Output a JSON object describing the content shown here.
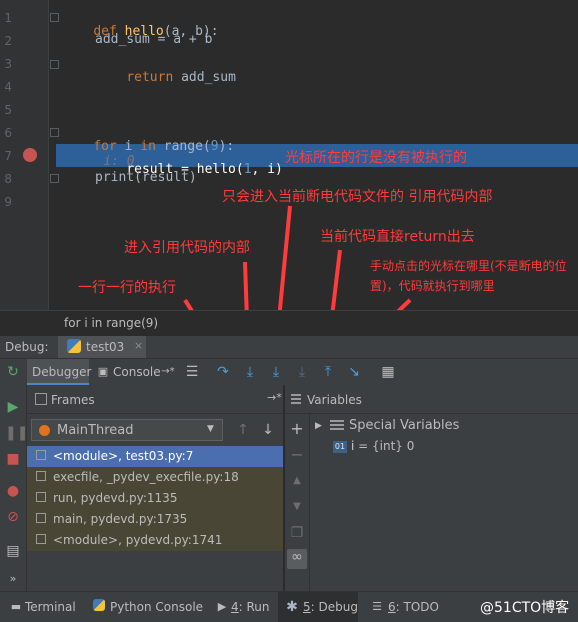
{
  "editor": {
    "lines": [
      {
        "num": "1"
      },
      {
        "num": "2"
      },
      {
        "num": "3"
      },
      {
        "num": "4"
      },
      {
        "num": "5"
      },
      {
        "num": "6"
      },
      {
        "num": "7"
      },
      {
        "num": "8"
      },
      {
        "num": "9"
      }
    ],
    "code": {
      "l1_kw": "def",
      "l1_fn": "hello",
      "l1_rest": "(a, b):",
      "l2": "add_sum = a + b",
      "l3_kw": "return",
      "l3_rest": " add_sum",
      "l6_kw1": "for",
      "l6_mid": " i ",
      "l6_kw2": "in",
      "l6_rest1": " range(",
      "l6_num": "9",
      "l6_rest2": "):",
      "l6_hint": "i: 0",
      "l7_a": "result = hello(",
      "l7_n1": "1",
      "l7_b": ", i)",
      "l8": "print(result)"
    },
    "breadcrumb": "for i in range(9)"
  },
  "annotations": {
    "cursor_line": "光标所在的行是没有被执行的",
    "step_into_my_code": "只会进入当前断电代码文件的 引用代码内部",
    "step_into": "进入引用代码的内部",
    "step_out": "当前代码直接return出去",
    "step_over": "一行一行的执行",
    "run_to_cursor": "手动点击的光标在哪里(不是断电的位置)，代码就执行到哪里"
  },
  "debug": {
    "label": "Debug:",
    "session_tab": "test03",
    "tabs": {
      "debugger": "Debugger",
      "console": "Console"
    },
    "frames_title": "Frames",
    "variables_title": "Variables",
    "thread": "MainThread",
    "frames": [
      "<module>, test03.py:7",
      "execfile, _pydev_execfile.py:18",
      "run, pydevd.py:1135",
      "main, pydevd.py:1735",
      "<module>, pydevd.py:1741"
    ],
    "variables": {
      "special": "Special Variables",
      "var_name": "i",
      "var_value": " = {int} 0",
      "var_badge": "01"
    }
  },
  "statusbar": {
    "terminal": "Terminal",
    "python_console": "Python Console",
    "run_num": "4",
    "run": ": Run",
    "debug_num": "5",
    "debug": ": Debug",
    "todo_num": "6",
    "todo": ": TODO",
    "watermark": "@51CTO博客"
  },
  "colors": {
    "breakpoint": "#c75450",
    "current_line": "#2d6099",
    "annotation": "#ff3b3b",
    "selected_frame": "#4b6eaf"
  }
}
